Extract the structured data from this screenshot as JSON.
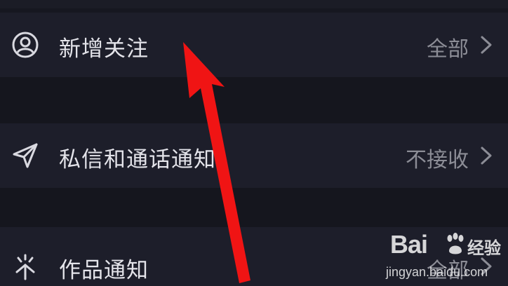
{
  "settings": {
    "rows": [
      {
        "label": "新增关注",
        "value": "全部",
        "icon": "user-circle-icon"
      },
      {
        "label": "私信和通话通知",
        "value": "不接收",
        "icon": "paper-plane-icon"
      },
      {
        "label": "作品通知",
        "value": "全部",
        "icon": "sparkle-icon"
      }
    ]
  },
  "overlay": {
    "arrow_color": "#f01414",
    "watermark_logo": "Bai",
    "watermark_logo_suffix": "经验",
    "watermark_url": "jingyan.baidu.com"
  }
}
